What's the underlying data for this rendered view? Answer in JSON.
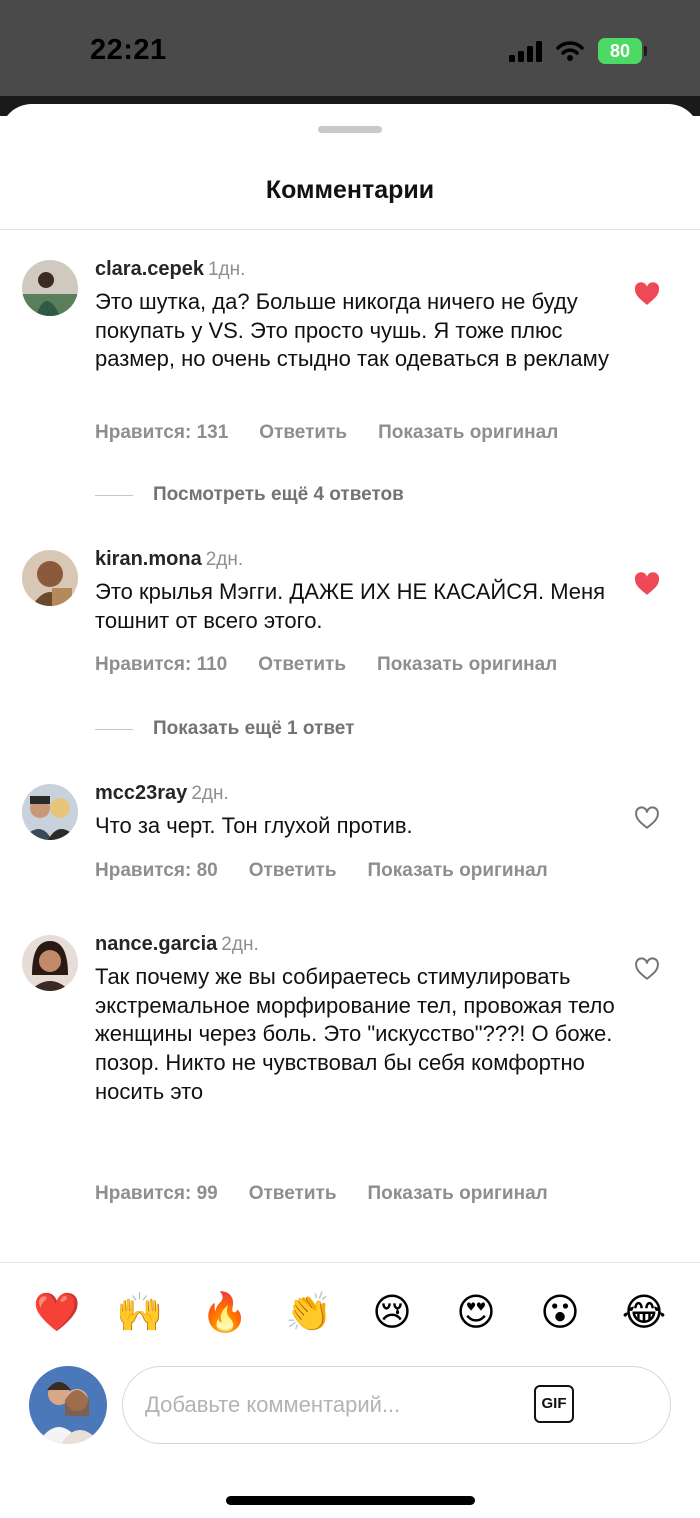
{
  "status_bar": {
    "time": "22:21",
    "battery": "80"
  },
  "sheet": {
    "title": "Комментарии"
  },
  "comments": [
    {
      "username": "clara.cepek",
      "age": "1дн.",
      "text": "Это шутка, да? Больше никогда ничего не буду покупать у VS. Это просто чушь. Я тоже плюс размер, но очень стыдно так одеваться в рекламу",
      "likes": "Нравится: 131",
      "reply": "Ответить",
      "show_original": "Показать оригинал",
      "liked": true,
      "more_replies": "Посмотреть ещё 4 ответов"
    },
    {
      "username": "kiran.mona",
      "age": "2дн.",
      "text": "Это крылья Мэгги. ДАЖЕ ИХ НЕ КАСАЙСЯ. Меня тошнит от всего этого.",
      "likes": "Нравится: 110",
      "reply": "Ответить",
      "show_original": "Показать оригинал",
      "liked": true,
      "more_replies": "Показать ещё 1 ответ"
    },
    {
      "username": "mcc23ray",
      "age": "2дн.",
      "text": "Что за черт. Тон глухой против.",
      "likes": "Нравится: 80",
      "reply": "Ответить",
      "show_original": "Показать оригинал",
      "liked": false
    },
    {
      "username": "nance.garcia",
      "age": "2дн.",
      "text": "Так почему же вы собираетесь стимулировать экстремальное морфирование тел, провожая тело женщины через боль. Это \"искусство\"???! О боже. позор. Никто не чувствовал бы себя комфортно носить это",
      "likes": "Нравится: 99",
      "reply": "Ответить",
      "show_original": "Показать оригинал",
      "liked": false
    }
  ],
  "reactions": [
    "❤️",
    "🙌",
    "🔥",
    "👏",
    "😢",
    "😍",
    "😮",
    "😂"
  ],
  "composer": {
    "placeholder": "Добавьте комментарий...",
    "gif_label": "GIF"
  },
  "colors": {
    "like_red": "#ed4956",
    "muted_text": "#8e8e8e",
    "battery_green": "#4cd964"
  }
}
